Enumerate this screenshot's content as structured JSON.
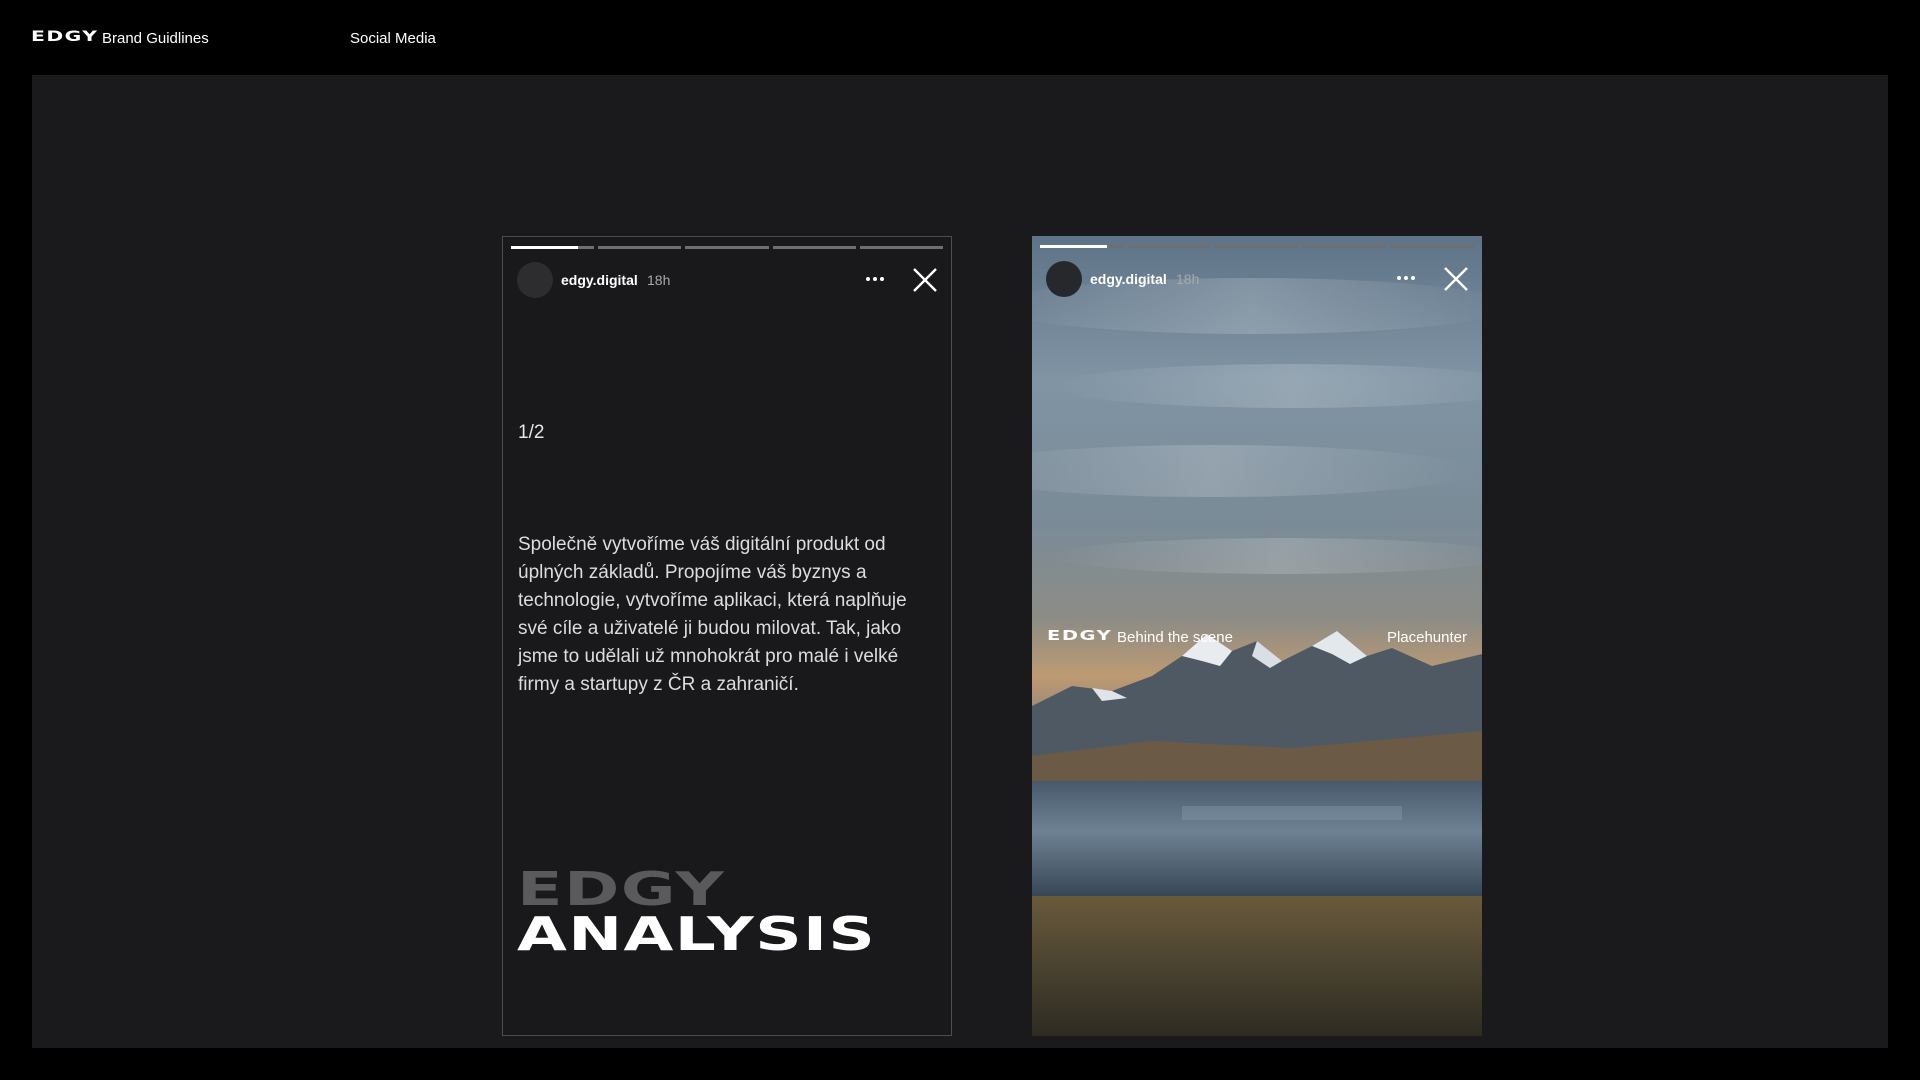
{
  "header": {
    "logo": "EDGY",
    "brand_label": "Brand Guidlines",
    "section_label": "Social Media"
  },
  "stories": [
    {
      "handle": "edgy.digital",
      "age": "18h",
      "progress": [
        0.8,
        0,
        0,
        0,
        0
      ],
      "counter": "1/2",
      "body": "Společně vytvoříme váš digitální produkt od úplných základů. Propojíme váš byznys a technologie, vytvoříme aplikaci, která naplňuje své cíle a uživatelé ji budou milovat. Tak, jako jsme to udělali už mnohokrát pro malé i velké firmy a startupy z ČR a zahraničí.",
      "headline_top": "EDGY",
      "headline_bottom": "ANALYSIS"
    },
    {
      "handle": "edgy.digital",
      "age": "18h",
      "progress": [
        0.8,
        0,
        0,
        0,
        0
      ],
      "overlay_logo": "EDGY",
      "overlay_caption": "Behind the scene",
      "overlay_right": "Placehunter"
    }
  ],
  "icons": {
    "more": "more-horizontal-icon",
    "close": "close-icon"
  },
  "colors": {
    "page_background": "#000000",
    "canvas_background": "#1a191b",
    "headline_muted": "#5a595c",
    "progress_track": "#6f6e72"
  }
}
